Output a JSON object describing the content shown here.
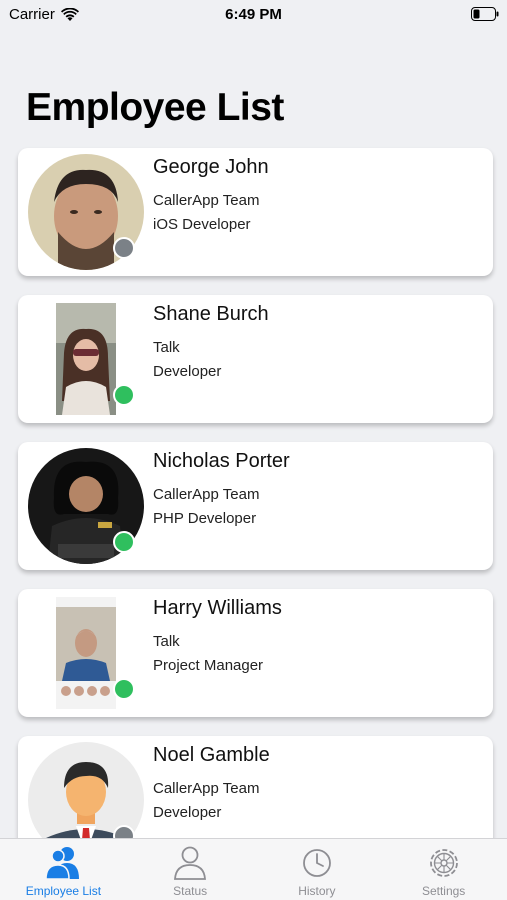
{
  "status_bar": {
    "carrier": "Carrier",
    "time": "6:49 PM"
  },
  "page_title": "Employee List",
  "employees": [
    {
      "name": "George John",
      "team": "CallerApp Team",
      "role": "iOS Developer",
      "presence": "offline",
      "presence_color": "#7b8187"
    },
    {
      "name": "Shane Burch",
      "team": "Talk",
      "role": "Developer",
      "presence": "online",
      "presence_color": "#2fbf5e"
    },
    {
      "name": "Nicholas Porter",
      "team": "CallerApp Team",
      "role": "PHP Developer",
      "presence": "online",
      "presence_color": "#2fbf5e"
    },
    {
      "name": "Harry Williams",
      "team": "Talk",
      "role": "Project Manager",
      "presence": "online",
      "presence_color": "#2fbf5e"
    },
    {
      "name": "Noel Gamble",
      "team": "CallerApp Team",
      "role": "Developer",
      "presence": "offline",
      "presence_color": "#7b8187"
    }
  ],
  "tabs": [
    {
      "label": "Employee List",
      "icon": "users-icon",
      "active": true
    },
    {
      "label": "Status",
      "icon": "person-icon",
      "active": false
    },
    {
      "label": "History",
      "icon": "clock-icon",
      "active": false
    },
    {
      "label": "Settings",
      "icon": "gear-icon",
      "active": false
    }
  ],
  "colors": {
    "accent": "#1a7ee5",
    "inactive": "#8e8e93",
    "online": "#2fbf5e",
    "offline": "#7b8187"
  }
}
